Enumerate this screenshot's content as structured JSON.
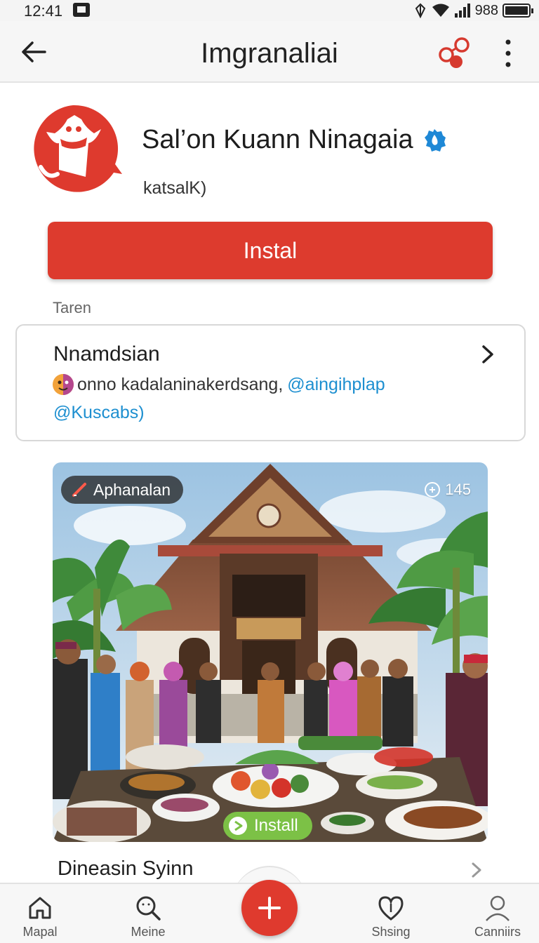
{
  "status_bar": {
    "time": "12:41",
    "battery_text": "988"
  },
  "app_bar": {
    "title": "Imgranaliai"
  },
  "app": {
    "name": "Sal’on Kuann Ninagaia",
    "developer": "katsalK)",
    "install_label": "Instal"
  },
  "section_label": "Taren",
  "info_card": {
    "title": "Nnamdsian",
    "text": "onno kadalaninakerdsang,",
    "mention_1": "@aingihplap",
    "mention_2": "@Kuscabs)"
  },
  "media": {
    "tag_label": "Aphanalan",
    "count": "145",
    "install_label": "Install"
  },
  "next_section": {
    "title": "Dineasin Syinn"
  },
  "bottom_nav": {
    "items": [
      {
        "label": "Mapal",
        "icon": "home-icon"
      },
      {
        "label": "Meine",
        "icon": "search-icon"
      },
      {
        "label": "Shsing",
        "icon": "heart-icon"
      },
      {
        "label": "Canniirs",
        "icon": "profile-icon"
      }
    ],
    "fab_icon": "plus-icon"
  },
  "colors": {
    "accent": "#dd3b2e",
    "link": "#1d8fd0",
    "install_green": "#7cc146",
    "verified": "#1e88d6"
  }
}
